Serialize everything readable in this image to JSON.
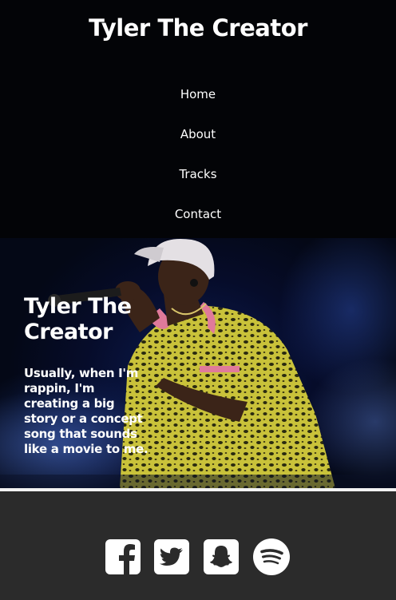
{
  "header": {
    "title": "Tyler The Creator",
    "nav": [
      {
        "label": "Home"
      },
      {
        "label": "About"
      },
      {
        "label": "Tracks"
      },
      {
        "label": "Contact"
      }
    ]
  },
  "hero": {
    "heading": "Tyler The Creator",
    "quote": "Usually, when I'm rappin, I'm creating a big story or a concept song that sounds like a movie to me.",
    "image_subject": "performer-with-microphone"
  },
  "footer": {
    "social": [
      {
        "icon": "facebook-icon"
      },
      {
        "icon": "twitter-icon"
      },
      {
        "icon": "snapchat-icon"
      },
      {
        "icon": "spotify-icon"
      }
    ]
  },
  "colors": {
    "header_bg": "#030407",
    "footer_bg": "#2b2b2b",
    "text": "#ffffff",
    "hero_blue": "#0d1d55",
    "shirt_yellow": "#c9c23a",
    "collar_pink": "#e07a9a"
  }
}
